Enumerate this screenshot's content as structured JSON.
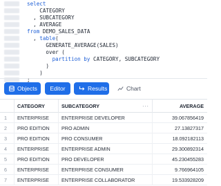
{
  "editor": {
    "lines": [
      [
        {
          "t": "select",
          "c": "kw"
        }
      ],
      [
        {
          "t": "    CATEGORY",
          "c": "tx"
        }
      ],
      [
        {
          "t": "  , SUBCATEGORY",
          "c": "tx"
        }
      ],
      [
        {
          "t": "  , AVERAGE",
          "c": "tx"
        }
      ],
      [
        {
          "t": "from",
          "c": "kw"
        },
        {
          "t": " DEMO_SALES_DATA",
          "c": "tx"
        }
      ],
      [
        {
          "t": "  , ",
          "c": "tx"
        },
        {
          "t": "table",
          "c": "kw"
        },
        {
          "t": "(",
          "c": "tx"
        }
      ],
      [
        {
          "t": "      GENERATE_AVERAGE(SALES)",
          "c": "fn"
        }
      ],
      [
        {
          "t": "      over (",
          "c": "tx"
        }
      ],
      [
        {
          "t": "        partition by",
          "c": "kw"
        },
        {
          "t": " CATEGORY, SUBCATEGORY",
          "c": "tx"
        }
      ],
      [
        {
          "t": "      )",
          "c": "tx"
        }
      ],
      [
        {
          "t": "    )",
          "c": "tx"
        }
      ],
      [
        {
          "t": ";",
          "c": "tx"
        }
      ]
    ]
  },
  "tabs": {
    "objects": "Objects",
    "editor": "Editor",
    "results": "Results",
    "chart": "Chart"
  },
  "table": {
    "columns": [
      "CATEGORY",
      "SUBCATEGORY",
      "AVERAGE"
    ],
    "more_icon": "···",
    "rows": [
      {
        "n": "1",
        "category": "ENTERPRISE",
        "subcategory": "ENTERPRISE DEVELOPER",
        "average": "39.067856419"
      },
      {
        "n": "2",
        "category": "PRO EDITION",
        "subcategory": "PRO ADMIN",
        "average": "27.13827317"
      },
      {
        "n": "3",
        "category": "PRO EDITION",
        "subcategory": "PRO CONSUMER",
        "average": "18.092182113"
      },
      {
        "n": "4",
        "category": "ENTERPRISE",
        "subcategory": "ENTERPRISE ADMIN",
        "average": "29.300892314"
      },
      {
        "n": "5",
        "category": "PRO EDITION",
        "subcategory": "PRO DEVELOPER",
        "average": "45.230455283"
      },
      {
        "n": "6",
        "category": "ENTERPRISE",
        "subcategory": "ENTERPRISE CONSUMER",
        "average": "9.766964105"
      },
      {
        "n": "7",
        "category": "ENTERPRISE",
        "subcategory": "ENTERPRISE COLLABORATOR",
        "average": "19.533928209"
      }
    ]
  }
}
